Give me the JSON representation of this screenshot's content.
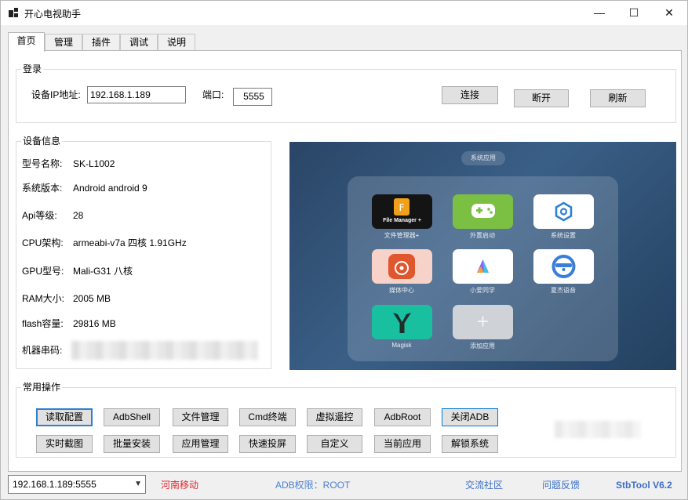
{
  "window": {
    "title": "开心电视助手",
    "minimize": "—",
    "maximize": "☐",
    "close": "✕"
  },
  "tabs": [
    "首页",
    "管理",
    "插件",
    "调试",
    "说明"
  ],
  "login": {
    "group_label": "登录",
    "ip_label": "设备IP地址:",
    "ip_value": "192.168.1.189",
    "port_label": "端口:",
    "port_value": "5555",
    "connect": "连接",
    "disconnect": "断开",
    "refresh": "刷新"
  },
  "device": {
    "group_label": "设备信息",
    "rows": [
      {
        "label": "型号名称:",
        "value": "SK-L1002"
      },
      {
        "label": "系统版本:",
        "value": "Android android 9"
      },
      {
        "label": "Api等级:",
        "value": "28"
      },
      {
        "label": "CPU架构:",
        "value": "armeabi-v7a 四核 1.91GHz"
      },
      {
        "label": "GPU型号:",
        "value": "Mali-G31 八核"
      },
      {
        "label": "RAM大小:",
        "value": "2005 MB"
      },
      {
        "label": "flash容量:",
        "value": "29816 MB"
      },
      {
        "label": "机器串码:",
        "value": ""
      }
    ]
  },
  "screenshot": {
    "header": "系统应用",
    "apps": [
      {
        "name": "文件管理器+",
        "tile_text": "File Manager +",
        "color": "#1a1a1a"
      },
      {
        "name": "外置启动",
        "tile_text": "",
        "color": "#7cc043"
      },
      {
        "name": "系统设置",
        "tile_text": "",
        "color": "#ffffff"
      },
      {
        "name": "媒体中心",
        "tile_text": "",
        "color": "#f6d2c8"
      },
      {
        "name": "小爱同学",
        "tile_text": "",
        "color": "#ffffff"
      },
      {
        "name": "夏杰语音",
        "tile_text": "",
        "color": "#ffffff"
      },
      {
        "name": "Magisk",
        "tile_text": "",
        "color": "#19c0a0"
      },
      {
        "name": "添加应用",
        "tile_text": "+",
        "color": "#cfd3d8"
      }
    ]
  },
  "ops": {
    "group_label": "常用操作",
    "row1": [
      "读取配置",
      "AdbShell",
      "文件管理",
      "Cmd终端",
      "虚拟遥控",
      "AdbRoot",
      "关闭ADB"
    ],
    "row2": [
      "实时截图",
      "批量安装",
      "应用管理",
      "快速投屏",
      "自定义",
      "当前应用",
      "解锁系统"
    ]
  },
  "status": {
    "device": "192.168.1.189:5555",
    "carrier": "河南移动",
    "adb": "ADB权限：ROOT",
    "community": "交流社区",
    "feedback": "问题反馈",
    "version": "StbTool V6.2"
  },
  "colors": {
    "accent": "#2f7fd0",
    "carrier": "#e0282e",
    "link": "#3c6fc6",
    "adb": "#4a80d0"
  }
}
